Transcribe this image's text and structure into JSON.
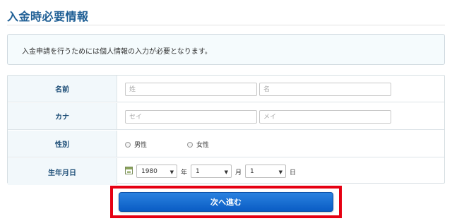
{
  "page": {
    "title": "入金時必要情報"
  },
  "notice": {
    "text": "入金申請を行うためには個人情報の入力が必要となります。"
  },
  "form": {
    "name": {
      "label": "名前",
      "last_placeholder": "姓",
      "first_placeholder": "名"
    },
    "kana": {
      "label": "カナ",
      "last_placeholder": "セイ",
      "first_placeholder": "メイ"
    },
    "gender": {
      "label": "性別",
      "options": [
        "男性",
        "女性"
      ]
    },
    "birthday": {
      "label": "生年月日",
      "year": {
        "value": "1980",
        "unit": "年"
      },
      "month": {
        "value": "1",
        "unit": "月"
      },
      "day": {
        "value": "1",
        "unit": "日"
      }
    }
  },
  "actions": {
    "next_label": "次へ進む"
  },
  "colors": {
    "title": "#1f5f95",
    "button": "#0a5cc4",
    "highlight_border": "#e60012"
  }
}
